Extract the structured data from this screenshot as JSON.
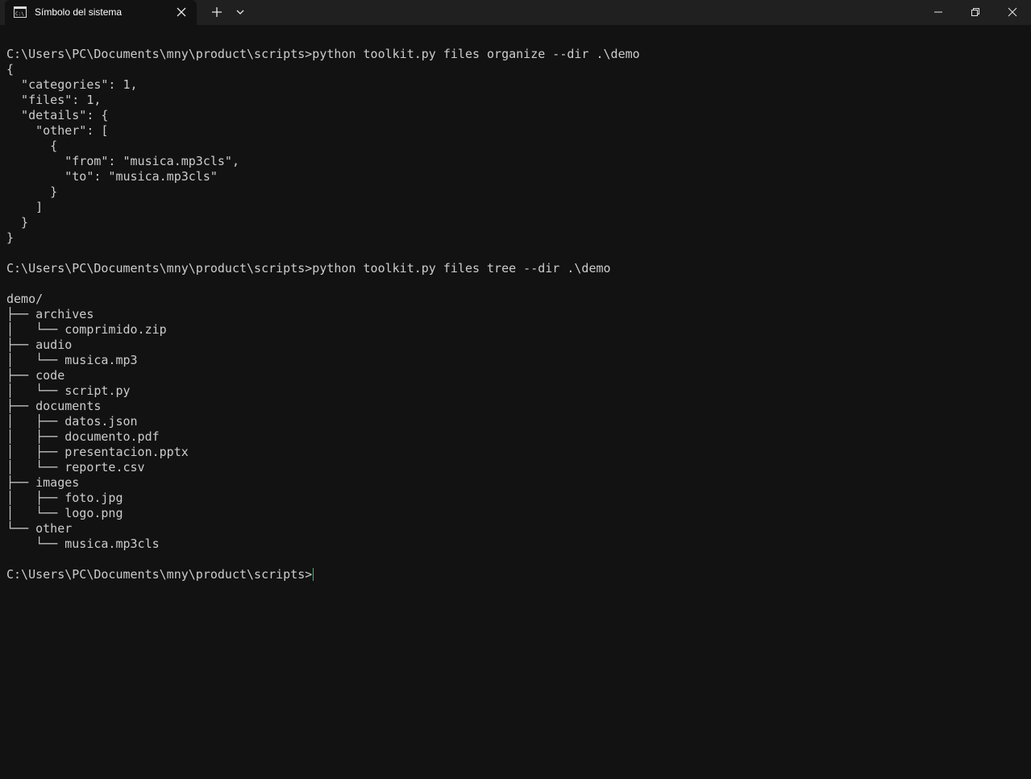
{
  "window": {
    "tab_title": "Símbolo del sistema",
    "tab_icon": "console-icon",
    "close_tab_icon": "close-icon",
    "new_tab_icon": "plus-icon",
    "dropdown_icon": "chevron-down-icon",
    "minimize_icon": "minimize-icon",
    "maximize_icon": "restore-icon",
    "close_window_icon": "close-icon"
  },
  "colors": {
    "background": "#121212",
    "titlebar": "#202020",
    "text": "#cccccc",
    "cursor": "#2fbf71"
  },
  "console": {
    "lines": [
      "",
      "C:\\Users\\PC\\Documents\\mny\\product\\scripts>python toolkit.py files organize --dir .\\demo",
      "{",
      "  \"categories\": 1,",
      "  \"files\": 1,",
      "  \"details\": {",
      "    \"other\": [",
      "      {",
      "        \"from\": \"musica.mp3cls\",",
      "        \"to\": \"musica.mp3cls\"",
      "      }",
      "    ]",
      "  }",
      "}",
      "",
      "C:\\Users\\PC\\Documents\\mny\\product\\scripts>python toolkit.py files tree --dir .\\demo",
      "",
      "demo/",
      "├── archives",
      "│   └── comprimido.zip",
      "├── audio",
      "│   └── musica.mp3",
      "├── code",
      "│   └── script.py",
      "├── documents",
      "│   ├── datos.json",
      "│   ├── documento.pdf",
      "│   ├── presentacion.pptx",
      "│   └── reporte.csv",
      "├── images",
      "│   ├── foto.jpg",
      "│   └── logo.png",
      "└── other",
      "    └── musica.mp3cls",
      "",
      "C:\\Users\\PC\\Documents\\mny\\product\\scripts>"
    ]
  }
}
